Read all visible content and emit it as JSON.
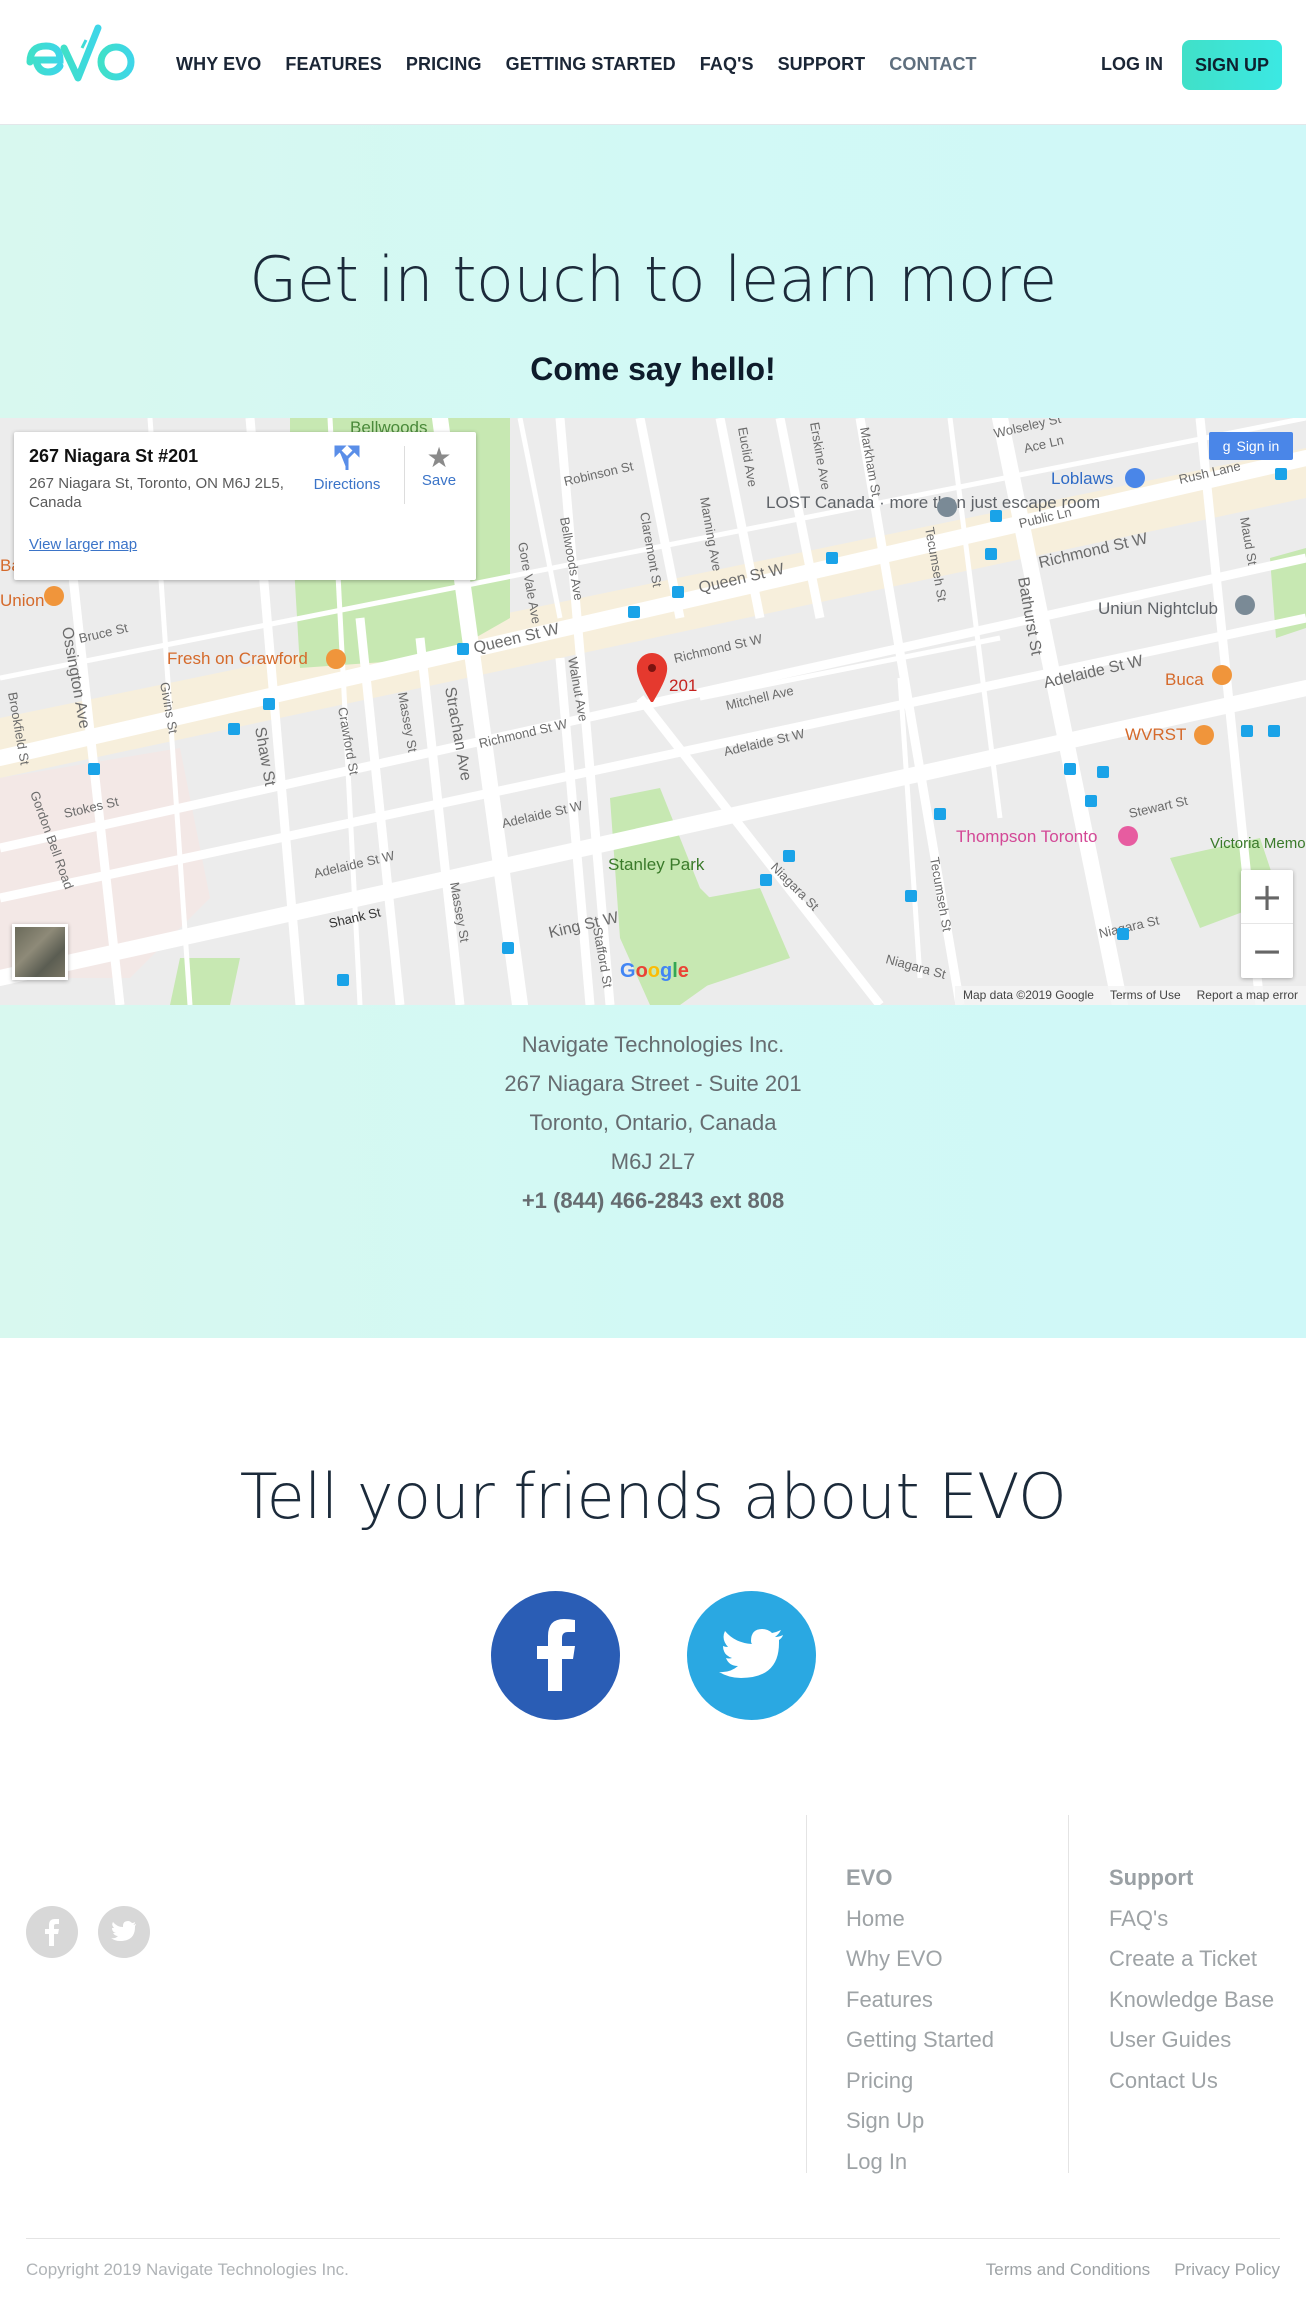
{
  "header": {
    "logo_alt": "evo",
    "nav": [
      "WHY EVO",
      "FEATURES",
      "PRICING",
      "GETTING STARTED",
      "FAQ'S",
      "SUPPORT",
      "CONTACT"
    ],
    "active_nav": "CONTACT",
    "login": "LOG IN",
    "signup": "SIGN UP",
    "accent_color": "#40e0c8"
  },
  "hero": {
    "title": "Get in touch to learn more",
    "subtitle": "Come say hello!"
  },
  "map": {
    "info_title": "267 Niagara St #201",
    "info_address": "267 Niagara St, Toronto, ON M6J 2L5, Canada",
    "view_larger": "View larger map",
    "directions": "Directions",
    "save": "Save",
    "sign_in": "Sign in",
    "marker_label": "201",
    "google": "Google",
    "footer": [
      "Map data ©2019 Google",
      "Terms of Use",
      "Report a map error"
    ],
    "streets": [
      "Queen St W",
      "Richmond St W",
      "Adelaide St W",
      "King St W",
      "Strachan Ave",
      "Shaw St",
      "Ossington Ave",
      "Bathurst St",
      "Niagara St",
      "Tecumseh St",
      "Bellwoods Ave",
      "Claremont St",
      "Manning Ave",
      "Euclid Ave",
      "Markham St",
      "Crawford St",
      "Massey St",
      "Walnut Ave",
      "Stafford St",
      "Mitchell Ave",
      "Stewart St",
      "Wolseley St",
      "Robinson St",
      "Bruce St",
      "Givins St",
      "Gore Vale Ave",
      "Brookfield St",
      "Gordon Bell Road",
      "Stokes St",
      "Shank St",
      "Rush Lane",
      "Public Ln",
      "Ace Ln",
      "Maud St",
      "Erskine Ave"
    ],
    "places": [
      "Bellwoods",
      "LOST Canada · more than just escape room",
      "Loblaws",
      "Uniun Nightclub",
      "Fresh on Crawford",
      "Buca",
      "WVRST",
      "Thompson Toronto",
      "Stanley Park",
      "Victoria Memorial Square",
      "Bakery",
      "Union"
    ]
  },
  "address": {
    "lines": [
      "Navigate Technologies Inc.",
      "267 Niagara Street - Suite 201",
      "Toronto, Ontario, Canada",
      "M6J 2L7"
    ],
    "phone": "+1 (844) 466-2843 ext 808"
  },
  "share": {
    "title": "Tell your friends about EVO",
    "facebook_icon": "facebook-icon",
    "twitter_icon": "twitter-icon",
    "facebook_color": "#2a5db5",
    "twitter_color": "#2aa8e2"
  },
  "footer": {
    "col1": {
      "heading": "EVO",
      "links": [
        "Home",
        "Why EVO",
        "Features",
        "Getting Started",
        "Pricing",
        "Sign Up",
        "Log In"
      ]
    },
    "col2": {
      "heading": "Support",
      "links": [
        "FAQ's",
        "Create a Ticket",
        "Knowledge Base",
        "User Guides",
        "Contact Us"
      ]
    },
    "copyright": "Copyright 2019 Navigate Technologies Inc.",
    "legal": [
      "Terms and Conditions",
      "Privacy Policy"
    ]
  }
}
